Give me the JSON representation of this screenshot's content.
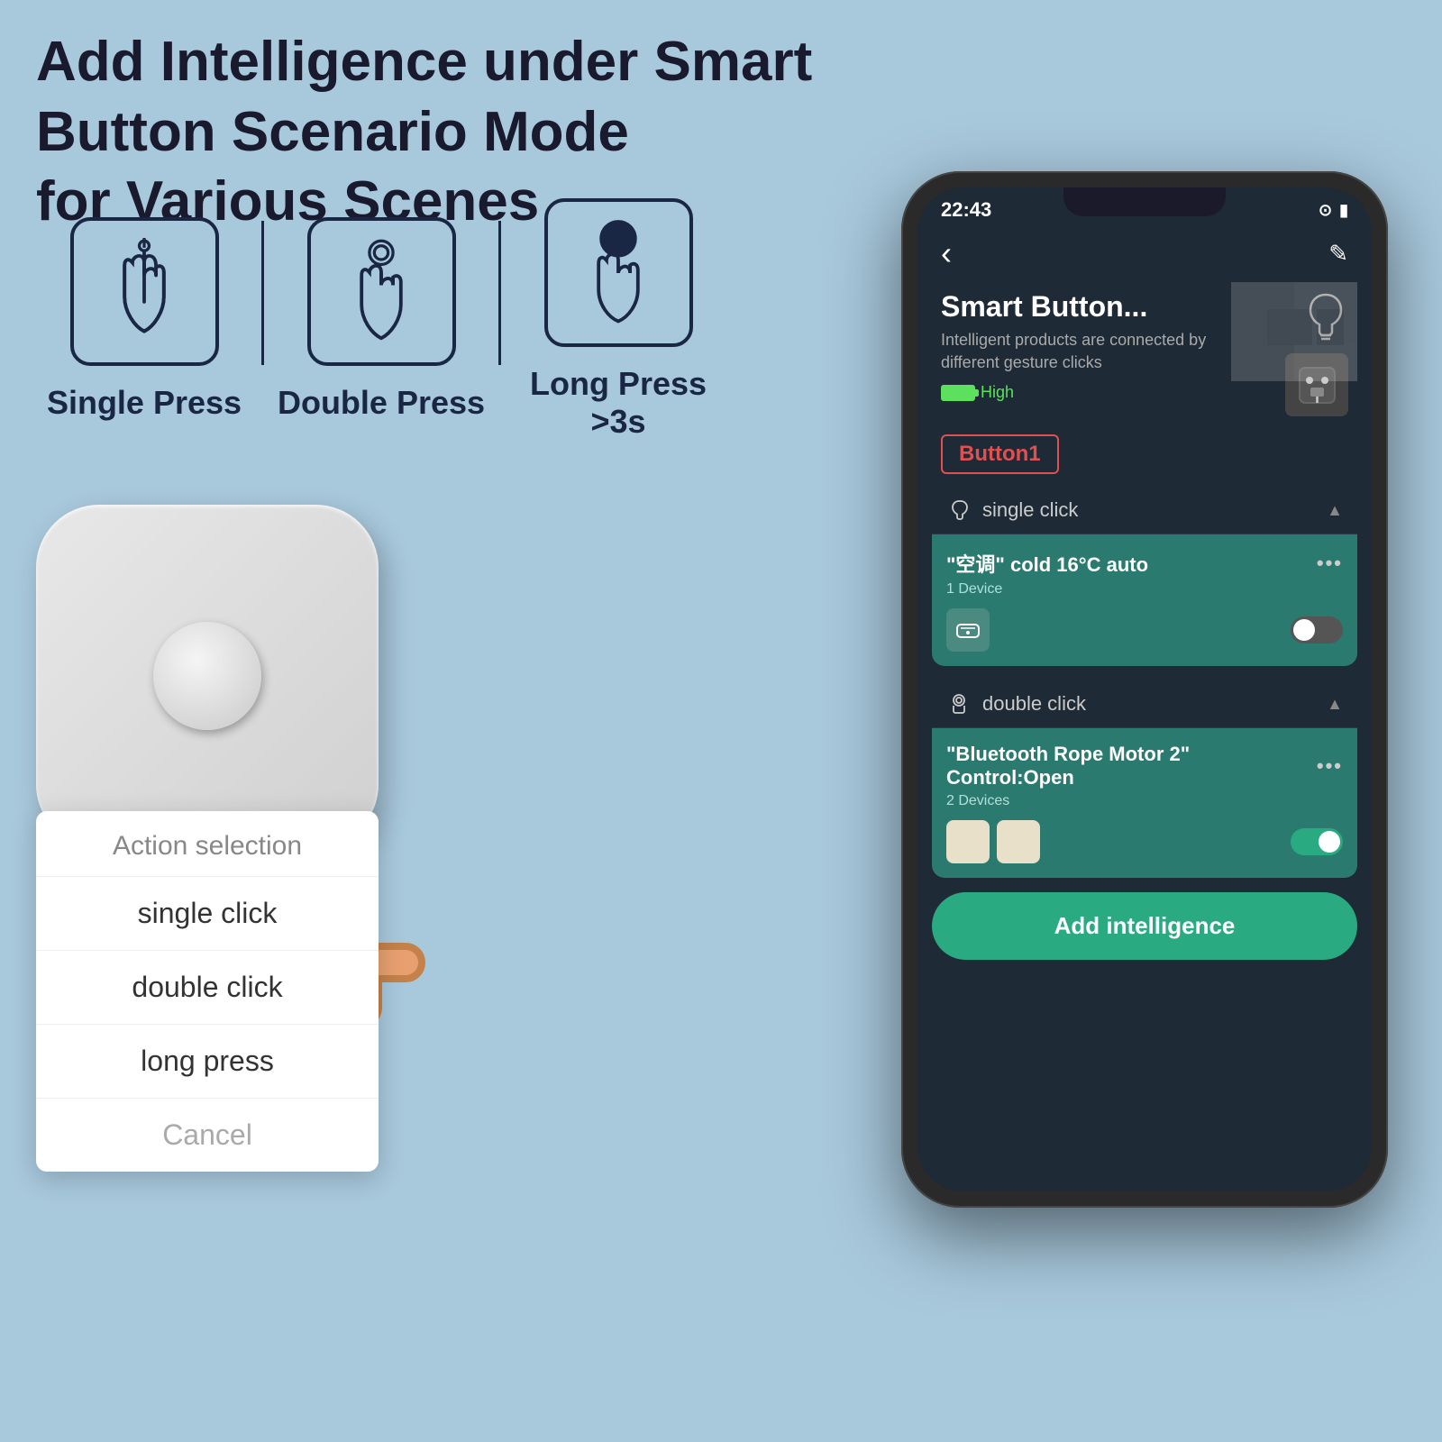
{
  "title": "Add Intelligence under Smart Button Scenario Mode\nfor Various Scenes",
  "press_types": [
    {
      "label": "Single Press",
      "id": "single-press"
    },
    {
      "label": "Double Press",
      "id": "double-press"
    },
    {
      "label": "Long Press >3s",
      "id": "long-press"
    }
  ],
  "action_popup": {
    "title": "Action selection",
    "items": [
      "single click",
      "double click",
      "long press"
    ],
    "cancel_label": "Cancel"
  },
  "phone": {
    "status": {
      "time": "22:43",
      "battery": "100%",
      "wifi": "WiFi"
    },
    "device_name": "Smart Button...",
    "device_desc": "Intelligent products are connected by different gesture clicks",
    "battery_level": "High",
    "button_label": "Button1",
    "click_sections": [
      {
        "type": "single click",
        "card_title": "\"空调\" cold 16°C auto",
        "card_sub": "1 Device",
        "toggle_on": false,
        "device_type": "ac"
      },
      {
        "type": "double click",
        "card_title": "\"Bluetooth Rope Motor 2\" Control:Open",
        "card_sub": "2 Devices",
        "toggle_on": true,
        "device_type": "blinds"
      }
    ],
    "add_btn_label": "Add intelligence"
  }
}
